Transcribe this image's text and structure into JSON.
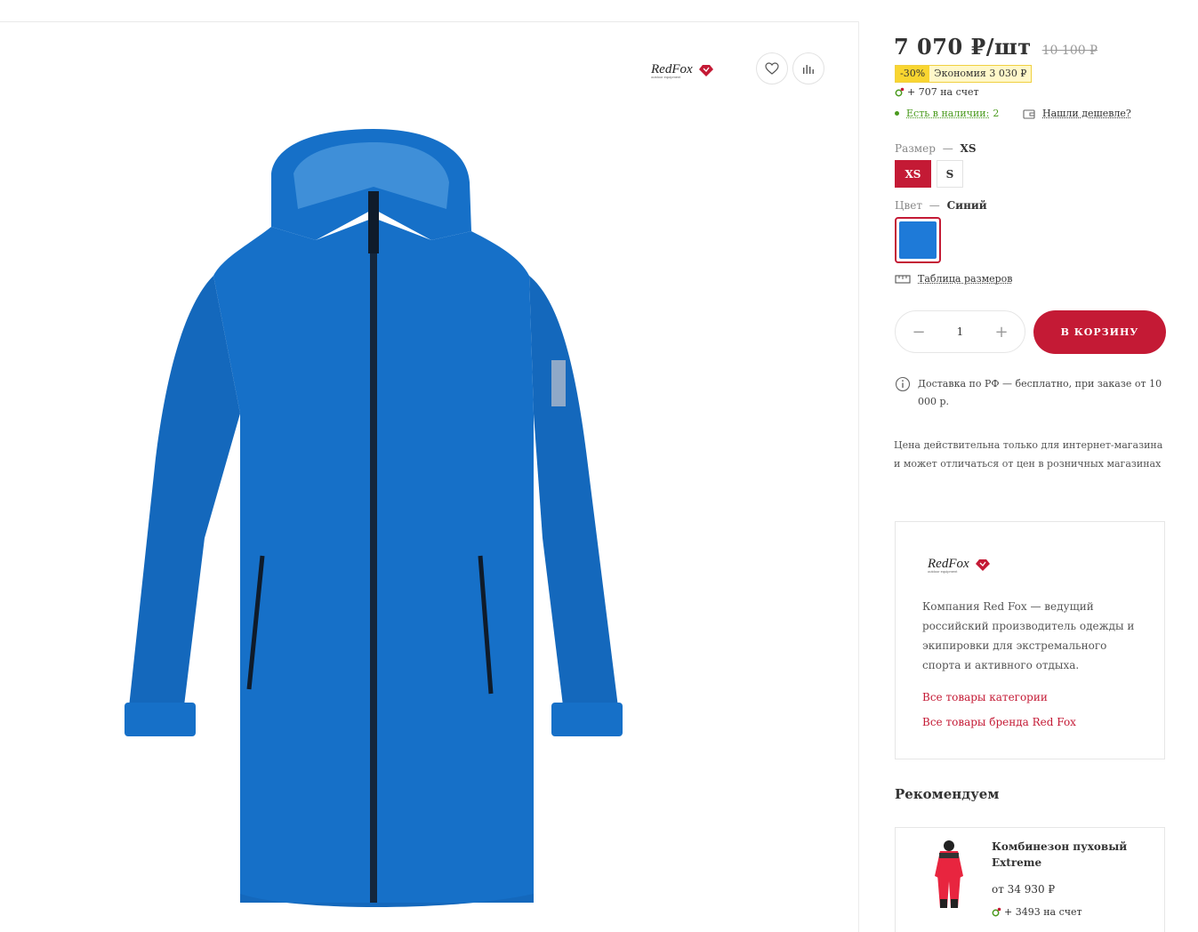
{
  "product": {
    "price": "7 070 ₽/шт",
    "old_price": "10 100 ₽",
    "discount_percent": "-30%",
    "discount_savings": "Экономия 3 030 ₽",
    "bonus": "+ 707 на счет",
    "stock_label": "Есть в наличии:",
    "stock_count": "2",
    "cheaper_label": "Нашли дешевле?",
    "size_label": "Размер",
    "size_selected": "XS",
    "sizes": [
      "XS",
      "S"
    ],
    "color_label": "Цвет",
    "color_selected": "Синий",
    "color_hex": "#1e7ad8",
    "size_table_label": "Таблица размеров",
    "quantity": "1",
    "minus": "−",
    "plus": "+",
    "cart_button": "В КОРЗИНУ",
    "delivery_text": "Доставка по РФ — бесплатно, при заказе от 10 000 р.",
    "disclaimer": "Цена действительна только для интернет-магазина и может отличаться от цен в розничных магазинах",
    "separator": "—"
  },
  "brand": {
    "logo_text": "RedFox",
    "logo_sub": "outdoor equipment",
    "description": "Компания Red Fox — ведущий российский производитель одежды и экипировки для экстремального спорта и активного отдыха.",
    "link_category": "Все товары категории",
    "link_brand": "Все товары бренда Red Fox"
  },
  "recommend": {
    "title": "Рекомендуем",
    "item_name": "Комбинезон пуховый Extreme",
    "item_price": "от 34 930 ₽",
    "item_bonus": "+ 3493 на счет"
  },
  "icons": {
    "wishlist": "heart-icon",
    "compare": "chart-icon",
    "bonus": "bonus-icon",
    "cheaper": "wallet-icon",
    "size_table": "ruler-icon",
    "info": "info-icon"
  },
  "colors": {
    "accent": "#c41a35",
    "in_stock": "#4a9a1e",
    "discount_bg": "#f9d530"
  }
}
